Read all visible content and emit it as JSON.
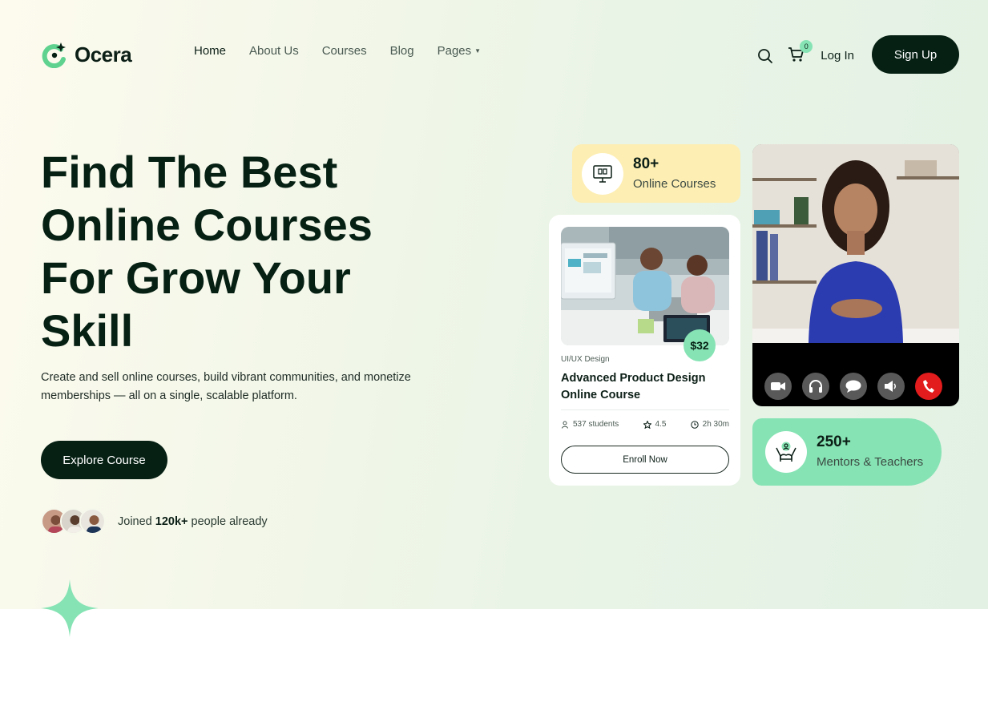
{
  "brand": {
    "name": "Ocera",
    "accent": "#86e3b4",
    "dark": "#062014"
  },
  "nav": {
    "items": [
      {
        "label": "Home"
      },
      {
        "label": "About Us"
      },
      {
        "label": "Courses"
      },
      {
        "label": "Blog"
      },
      {
        "label": "Pages"
      }
    ]
  },
  "header": {
    "cart_count": "0",
    "login_label": "Log In",
    "signup_label": "Sign Up"
  },
  "hero": {
    "headline_lines": [
      "Find The Best",
      "Online Courses",
      "For Grow Your",
      "Skill"
    ],
    "subtext": "Create and sell online courses, build vibrant communities, and monetize memberships — all on a single, scalable platform.",
    "cta_label": "Explore Course",
    "joined_prefix": "Joined",
    "joined_count": "120k+",
    "joined_suffix": "people already"
  },
  "stats": {
    "courses": {
      "value": "80+",
      "label": "Online Courses",
      "icon": "monitor-book-icon",
      "bg": "#fdeeb3"
    },
    "mentors": {
      "value": "250+",
      "label": "Mentors & Teachers",
      "icon": "mentor-hands-icon",
      "bg": "#86e3b4"
    }
  },
  "course_card": {
    "price": "$32",
    "category": "UI/UX Design",
    "title": "Advanced Product Design Online Course",
    "students": "537 students",
    "rating": "4.5",
    "duration": "2h 30m",
    "enroll_label": "Enroll Now"
  },
  "video_call": {
    "controls": [
      "camera-icon",
      "headset-icon",
      "chat-icon",
      "speaker-icon",
      "end-call-icon"
    ]
  }
}
